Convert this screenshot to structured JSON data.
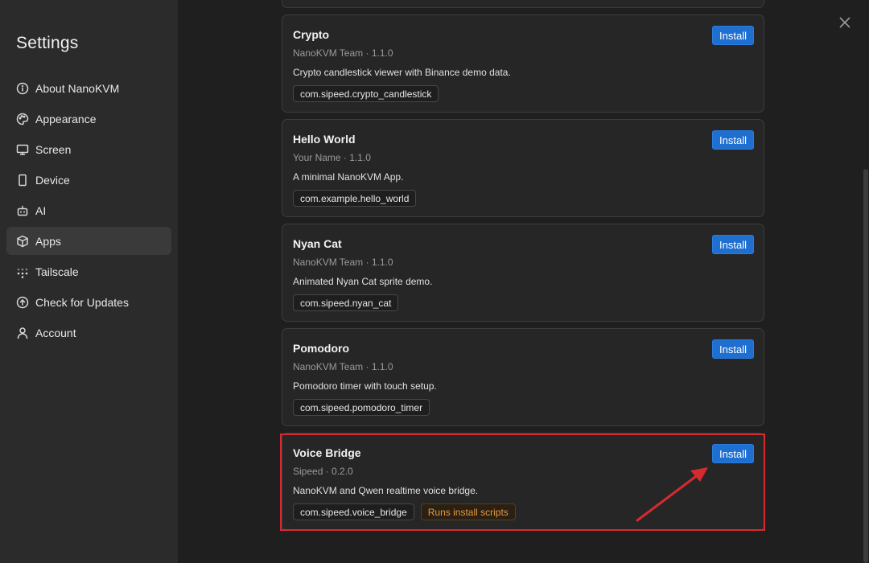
{
  "sidebar": {
    "title": "Settings",
    "items": [
      {
        "label": "About NanoKVM",
        "icon": "info-icon"
      },
      {
        "label": "Appearance",
        "icon": "palette-icon"
      },
      {
        "label": "Screen",
        "icon": "monitor-icon"
      },
      {
        "label": "Device",
        "icon": "device-icon"
      },
      {
        "label": "AI",
        "icon": "bot-icon"
      },
      {
        "label": "Apps",
        "icon": "package-icon",
        "active": true
      },
      {
        "label": "Tailscale",
        "icon": "tailscale-icon"
      },
      {
        "label": "Check for Updates",
        "icon": "upload-circle-icon"
      },
      {
        "label": "Account",
        "icon": "user-icon"
      }
    ]
  },
  "apps": [
    {
      "name": "Crypto",
      "meta": "NanoKVM Team · 1.1.0",
      "description": "Crypto candlestick viewer with Binance demo data.",
      "package": "com.sipeed.crypto_candlestick",
      "install_label": "Install"
    },
    {
      "name": "Hello World",
      "meta": "Your Name · 1.1.0",
      "description": "A minimal NanoKVM App.",
      "package": "com.example.hello_world",
      "install_label": "Install"
    },
    {
      "name": "Nyan Cat",
      "meta": "NanoKVM Team · 1.1.0",
      "description": "Animated Nyan Cat sprite demo.",
      "package": "com.sipeed.nyan_cat",
      "install_label": "Install"
    },
    {
      "name": "Pomodoro",
      "meta": "NanoKVM Team · 1.1.0",
      "description": "Pomodoro timer with touch setup.",
      "package": "com.sipeed.pomodoro_timer",
      "install_label": "Install"
    },
    {
      "name": "Voice Bridge",
      "meta": "Sipeed · 0.2.0",
      "description": "NanoKVM and Qwen realtime voice bridge.",
      "package": "com.sipeed.voice_bridge",
      "warning_tag": "Runs install scripts",
      "install_label": "Install"
    }
  ],
  "colors": {
    "accent": "#1f6fd1",
    "highlight": "#d52b30",
    "warning": "#e6993e"
  }
}
